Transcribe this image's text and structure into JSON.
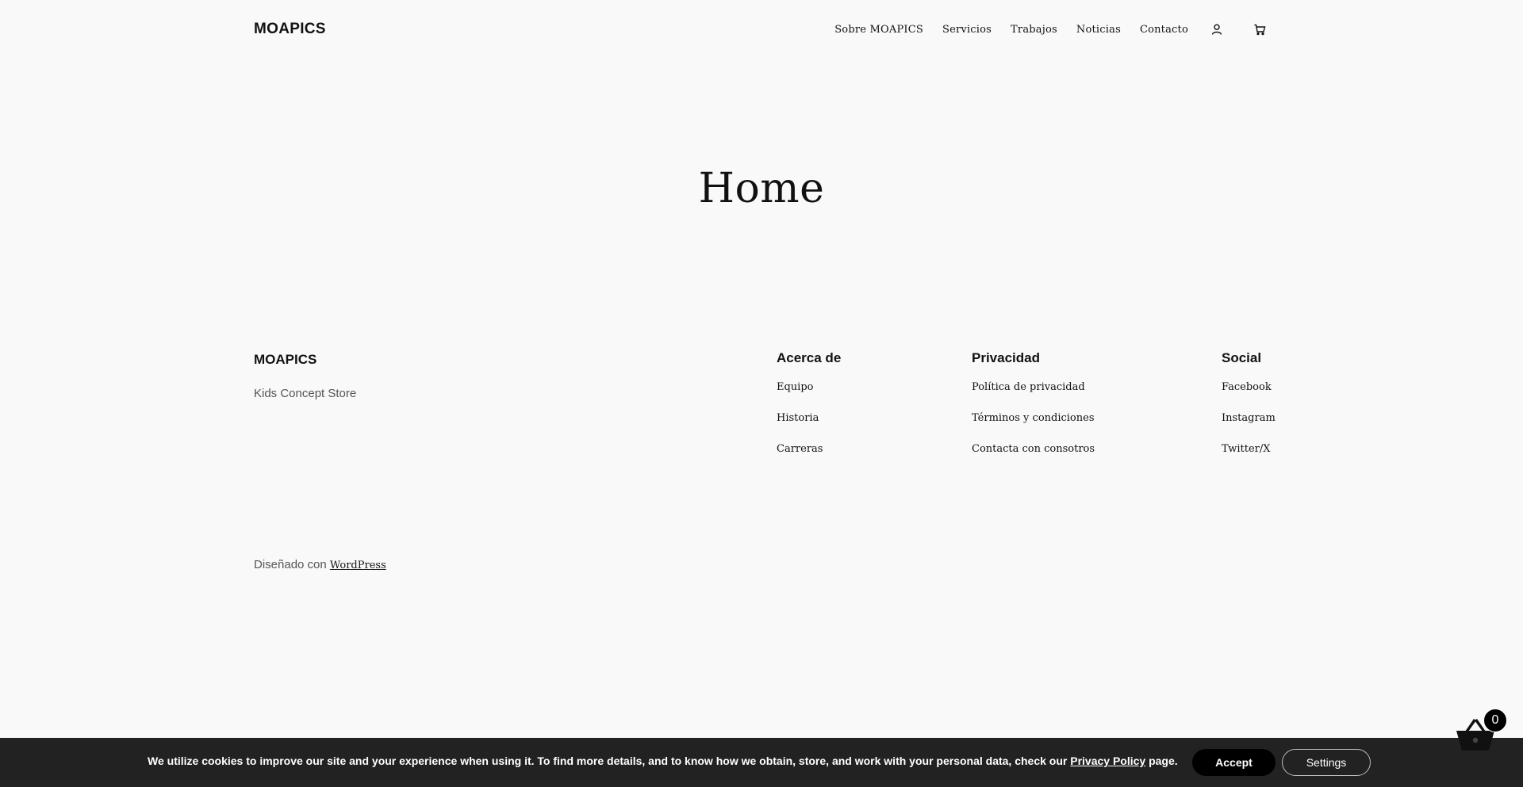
{
  "header": {
    "logo": "MOAPICS",
    "nav": [
      {
        "label": "Sobre MOAPICS",
        "name": "nav-sobre-moapics"
      },
      {
        "label": "Servicios",
        "name": "nav-servicios"
      },
      {
        "label": "Trabajos",
        "name": "nav-trabajos"
      },
      {
        "label": "Noticias",
        "name": "nav-noticias"
      },
      {
        "label": "Contacto",
        "name": "nav-contacto"
      }
    ],
    "icons": {
      "account": "account-icon",
      "cart": "cart-icon"
    }
  },
  "main": {
    "title": "Home"
  },
  "footer": {
    "brand": "MOAPICS",
    "tagline": "Kids Concept Store",
    "columns": [
      {
        "heading": "Acerca de",
        "links": [
          "Equipo",
          "Historia",
          "Carreras"
        ]
      },
      {
        "heading": "Privacidad",
        "links": [
          "Política de privacidad",
          "Términos y condiciones",
          "Contacta con consotros"
        ]
      },
      {
        "heading": "Social",
        "links": [
          "Facebook",
          "Instagram",
          "Twitter/X"
        ]
      }
    ],
    "credit_prefix": "Diseñado con ",
    "credit_link": "WordPress"
  },
  "cookie_bar": {
    "text_before": "We utilize cookies to improve our site and your experience when using it. To find more details, and to know how we obtain, store, and work with your personal data, check our ",
    "link": "Privacy Policy",
    "text_after": " page.",
    "accept_label": "Accept",
    "settings_label": "Settings"
  },
  "basket": {
    "count": "0",
    "icon": "basket-icon"
  },
  "colors": {
    "background": "#f9f9f9",
    "text": "#111111",
    "muted_text": "#555555",
    "cookie_bar": "#222222",
    "button_dark": "#000000"
  }
}
